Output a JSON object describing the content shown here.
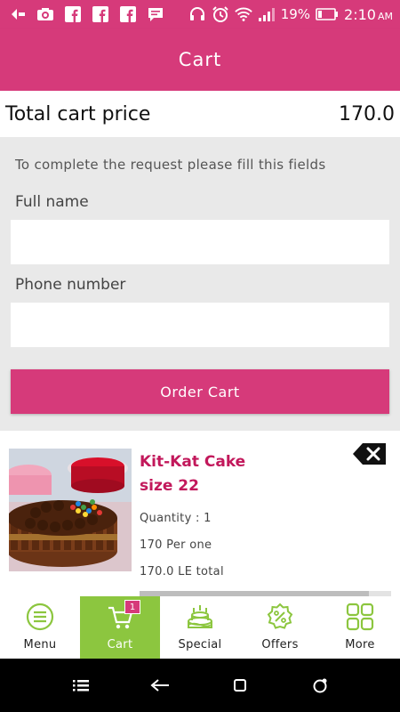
{
  "status_bar": {
    "battery": "19%",
    "time": "2:10",
    "ampm": "AM",
    "icons": [
      "usb-debug-icon",
      "camera-icon",
      "facebook-icon",
      "facebook-icon",
      "facebook-icon",
      "message-icon",
      "headset-icon",
      "alarm-icon",
      "wifi-icon",
      "signal-icon",
      "battery-icon"
    ]
  },
  "app_bar": {
    "title": "Cart"
  },
  "cart_total": {
    "label": "Total cart price",
    "value": "170.0"
  },
  "form": {
    "hint": "To complete the request please fill this fields",
    "full_name": {
      "label": "Full name",
      "value": "",
      "placeholder": ""
    },
    "phone": {
      "label": "Phone number",
      "value": "",
      "placeholder": ""
    },
    "submit_label": "Order Cart"
  },
  "cart_items": [
    {
      "name": "Kit-Kat Cake",
      "size": "size 22",
      "quantity": "Quantity : 1",
      "unit_price": "170 Per one",
      "total": "170.0 LE total",
      "image_icon": "cake-photo"
    }
  ],
  "bottom_nav": {
    "items": [
      {
        "label": "Menu",
        "icon": "menu-icon",
        "active": false
      },
      {
        "label": "Cart",
        "icon": "cart-icon",
        "active": true,
        "badge": "1"
      },
      {
        "label": "Special",
        "icon": "cake-icon",
        "active": false
      },
      {
        "label": "Offers",
        "icon": "percent-badge-icon",
        "active": false
      },
      {
        "label": "More",
        "icon": "grid-icon",
        "active": false
      }
    ]
  },
  "colors": {
    "primary": "#d63a7a",
    "accent_green": "#8cc63f",
    "title_pink": "#c2185b",
    "form_background": "#e9e9e9"
  }
}
